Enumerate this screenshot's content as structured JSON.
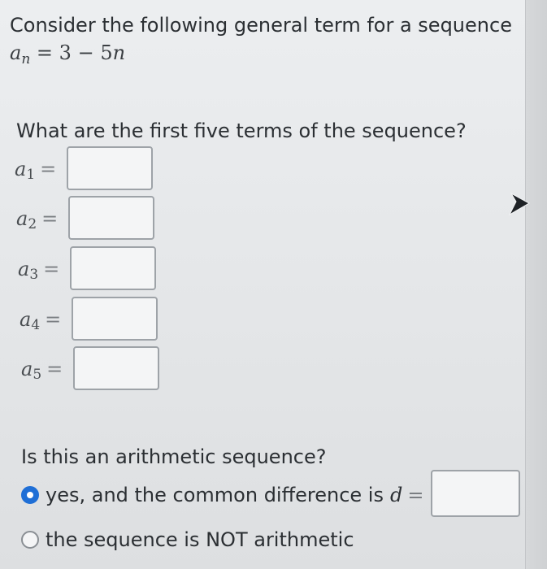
{
  "intro": "Consider the following general term for a sequence",
  "formula": {
    "var": "a",
    "sub": "n",
    "eq": "=",
    "rhs_const": "3",
    "minus": "−",
    "rhs_coef": "5",
    "rhs_var": "n"
  },
  "question": "What are the first five terms of the sequence?",
  "terms": [
    {
      "var": "a",
      "sub": "1",
      "eq": "=",
      "value": ""
    },
    {
      "var": "a",
      "sub": "2",
      "eq": "=",
      "value": ""
    },
    {
      "var": "a",
      "sub": "3",
      "eq": "=",
      "value": ""
    },
    {
      "var": "a",
      "sub": "4",
      "eq": "=",
      "value": ""
    },
    {
      "var": "a",
      "sub": "5",
      "eq": "=",
      "value": ""
    }
  ],
  "arithmetic": {
    "question": "Is this an arithmetic sequence?",
    "options": [
      {
        "label": "yes, and the common difference is",
        "checked": true
      },
      {
        "label": "the sequence is NOT arithmetic",
        "checked": false
      }
    ],
    "d_var": "d",
    "d_eq": "=",
    "d_value": ""
  },
  "colors": {
    "radio_selected": "#1f6fd6",
    "text": "#2b2f33",
    "input_border": "#9ea3a8"
  },
  "icons": {
    "cursor": "mouse-pointer-icon"
  }
}
